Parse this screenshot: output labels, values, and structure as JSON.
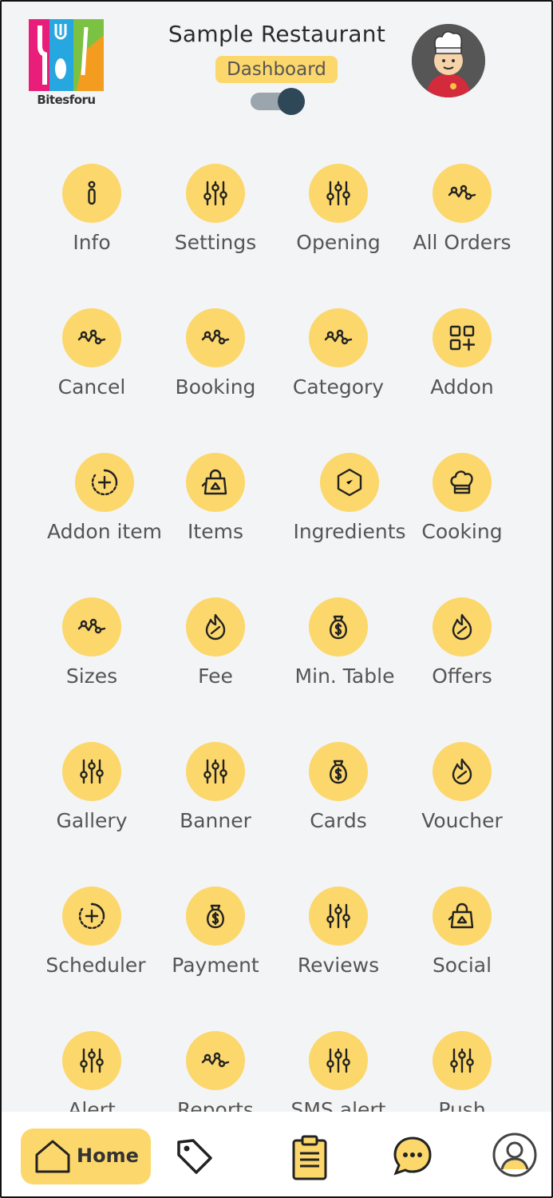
{
  "header": {
    "logo_text": "Bitesforu",
    "title": "Sample Restaurant",
    "badge": "Dashboard",
    "toggle_state": "on"
  },
  "grid": [
    {
      "label": "Info",
      "icon": "info-icon"
    },
    {
      "label": "Settings",
      "icon": "sliders-icon"
    },
    {
      "label": "Opening",
      "icon": "sliders-icon"
    },
    {
      "label": "All Orders",
      "icon": "activity-icon"
    },
    {
      "label": "Cancel",
      "icon": "activity-icon"
    },
    {
      "label": "Booking",
      "icon": "activity-icon"
    },
    {
      "label": "Category",
      "icon": "activity-icon"
    },
    {
      "label": "Addon",
      "icon": "grid-plus-icon"
    },
    {
      "label": "Addon item",
      "icon": "clock-plus-icon"
    },
    {
      "label": "Items",
      "icon": "bag-icon"
    },
    {
      "label": "Ingredients",
      "icon": "hexagon-check-icon"
    },
    {
      "label": "Cooking",
      "icon": "chef-hat-icon"
    },
    {
      "label": "Sizes",
      "icon": "activity-icon"
    },
    {
      "label": "Fee",
      "icon": "flame-icon"
    },
    {
      "label": "Min. Table",
      "icon": "money-bag-icon"
    },
    {
      "label": "Offers",
      "icon": "flame-icon"
    },
    {
      "label": "Gallery",
      "icon": "sliders-icon"
    },
    {
      "label": "Banner",
      "icon": "sliders-icon"
    },
    {
      "label": "Cards",
      "icon": "money-bag-icon"
    },
    {
      "label": "Voucher",
      "icon": "flame-icon"
    },
    {
      "label": "Scheduler",
      "icon": "clock-plus-icon"
    },
    {
      "label": "Payment",
      "icon": "money-bag-icon"
    },
    {
      "label": "Reviews",
      "icon": "sliders-icon"
    },
    {
      "label": "Social",
      "icon": "bag-icon"
    },
    {
      "label": "Alert",
      "icon": "sliders-icon"
    },
    {
      "label": "Reports",
      "icon": "activity-icon"
    },
    {
      "label": "SMS alert",
      "icon": "sliders-icon"
    },
    {
      "label": "Push",
      "icon": "sliders-icon"
    }
  ],
  "bottom_nav": {
    "home_label": "Home",
    "items": [
      "home-icon",
      "tag-icon",
      "clipboard-icon",
      "chat-icon",
      "profile-icon"
    ]
  },
  "colors": {
    "accent": "#fcd76b",
    "background": "#f3f4f6",
    "icon_stroke": "#222222"
  }
}
